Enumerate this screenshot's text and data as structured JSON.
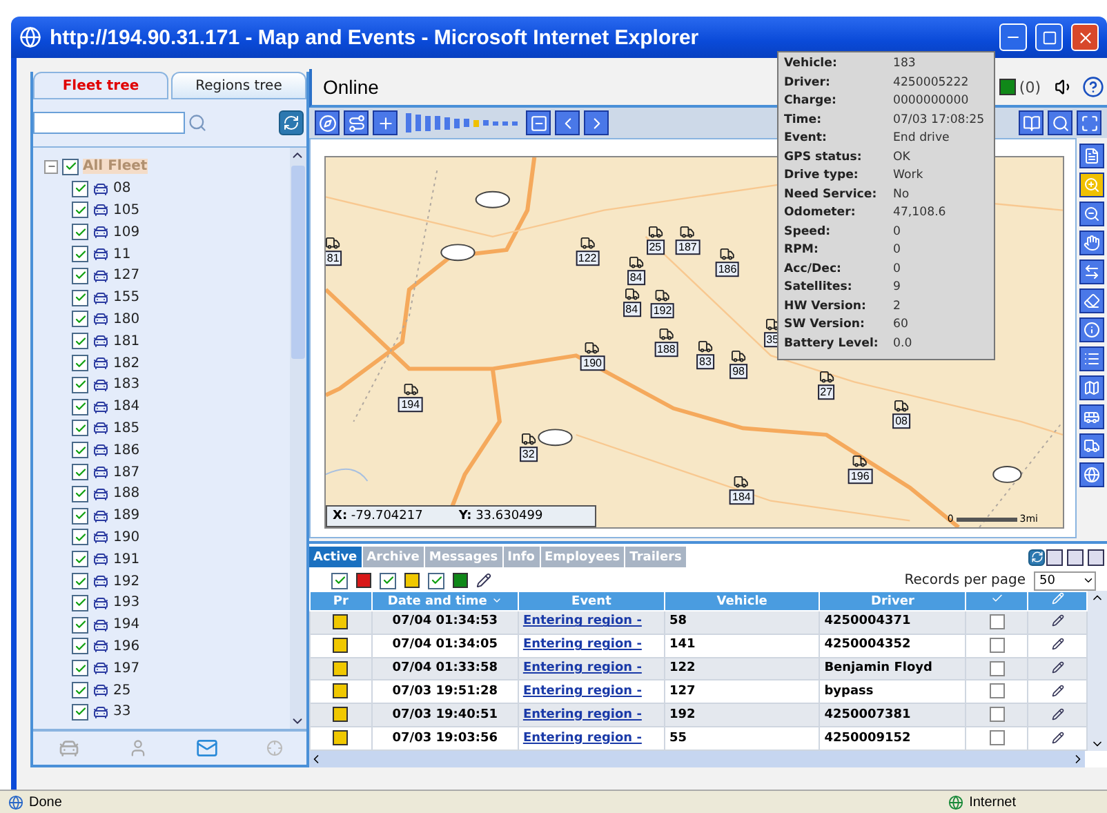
{
  "window": {
    "title": "http://194.90.31.171 - Map and Events - Microsoft Internet Explorer"
  },
  "sidebar": {
    "tabs": [
      {
        "label": "Fleet tree",
        "selected": true
      },
      {
        "label": "Regions tree",
        "selected": false
      }
    ],
    "tree": {
      "label": "All Fleet",
      "checked": true,
      "expanded": true,
      "selected": true,
      "children": [
        {
          "label": "08",
          "checked": true,
          "selected": false
        },
        {
          "label": "105",
          "checked": true,
          "selected": false
        },
        {
          "label": "109",
          "checked": true,
          "selected": false
        },
        {
          "label": "11",
          "checked": true,
          "selected": false
        },
        {
          "label": "127",
          "checked": true,
          "selected": false
        },
        {
          "label": "155",
          "checked": true,
          "selected": false
        },
        {
          "label": "180",
          "checked": true,
          "selected": false
        },
        {
          "label": "181",
          "checked": true,
          "selected": false
        },
        {
          "label": "182",
          "checked": true,
          "selected": false
        },
        {
          "label": "183",
          "checked": true,
          "selected": false
        },
        {
          "label": "184",
          "checked": true,
          "selected": false
        },
        {
          "label": "185",
          "checked": true,
          "selected": false
        },
        {
          "label": "186",
          "checked": true,
          "selected": false
        },
        {
          "label": "187",
          "checked": true,
          "selected": false
        },
        {
          "label": "188",
          "checked": true,
          "selected": false
        },
        {
          "label": "189",
          "checked": true,
          "selected": false
        },
        {
          "label": "190",
          "checked": true,
          "selected": false
        },
        {
          "label": "191",
          "checked": true,
          "selected": false
        },
        {
          "label": "192",
          "checked": true,
          "selected": false
        },
        {
          "label": "193",
          "checked": true,
          "selected": false
        },
        {
          "label": "194",
          "checked": true,
          "selected": false
        },
        {
          "label": "196",
          "checked": true,
          "selected": false
        },
        {
          "label": "197",
          "checked": true,
          "selected": false
        },
        {
          "label": "25",
          "checked": true,
          "selected": false
        },
        {
          "label": "33",
          "checked": true,
          "selected": false
        }
      ]
    }
  },
  "header": {
    "title": "Online",
    "alerts": "(0)"
  },
  "toolbar": {
    "zoom": {
      "level": 0.64
    }
  },
  "tooltip": {
    "rows": [
      {
        "label": "Vehicle:",
        "value": "183"
      },
      {
        "label": "Driver:",
        "value": "4250005222"
      },
      {
        "label": "Charge:",
        "value": "0000000000"
      },
      {
        "label": "Time:",
        "value": "07/03 17:08:25"
      },
      {
        "label": "Event:",
        "value": "End drive"
      },
      {
        "label": "GPS status:",
        "value": "OK"
      },
      {
        "label": "Drive type:",
        "value": "Work"
      },
      {
        "label": "Need Service:",
        "value": "No"
      },
      {
        "label": "Odometer:",
        "value": "47,108.6"
      },
      {
        "label": "Speed:",
        "value": "0"
      },
      {
        "label": "RPM:",
        "value": "0"
      },
      {
        "label": "Acc/Dec:",
        "value": "0"
      },
      {
        "label": "Satellites:",
        "value": "9"
      },
      {
        "label": "HW Version:",
        "value": "2"
      },
      {
        "label": "SW Version:",
        "value": "60"
      },
      {
        "label": "Battery Level:",
        "value": "0.0"
      }
    ]
  },
  "map": {
    "markers": [
      {
        "label": "81"
      },
      {
        "label": "122"
      },
      {
        "label": "25"
      },
      {
        "label": "187"
      },
      {
        "label": "186"
      },
      {
        "label": "84"
      },
      {
        "label": "84"
      },
      {
        "label": "192"
      },
      {
        "label": "188"
      },
      {
        "label": "83"
      },
      {
        "label": "98"
      },
      {
        "label": "190"
      },
      {
        "label": "194"
      },
      {
        "label": "32"
      },
      {
        "label": "27"
      },
      {
        "label": "08"
      },
      {
        "label": "196"
      },
      {
        "label": "184"
      },
      {
        "label": "35"
      }
    ],
    "coordinates": [
      {
        "label": "X:",
        "value": "-79.704217"
      },
      {
        "label": "Y:",
        "value": "33.630499"
      }
    ],
    "scale": {
      "start": "0",
      "end": "3mi"
    }
  },
  "events": {
    "tabs": [
      {
        "label": "Active",
        "selected": true
      },
      {
        "label": "Archive",
        "selected": false
      },
      {
        "label": "Messages",
        "selected": false
      },
      {
        "label": "Info",
        "selected": false
      },
      {
        "label": "Employees",
        "selected": false
      },
      {
        "label": "Trailers",
        "selected": false
      }
    ],
    "filters": [
      {
        "color": "#d81818",
        "checked": true
      },
      {
        "color": "#f0c800",
        "checked": true
      },
      {
        "color": "#108818",
        "checked": true
      }
    ],
    "records_label": "Records per page",
    "records_value": "50",
    "columns": [
      "Pr",
      "Date and time",
      "Event",
      "Vehicle",
      "Driver"
    ],
    "rows": [
      {
        "color": "#f0c800",
        "time": "07/04 01:34:53",
        "event": "Entering region -",
        "vehicle": "58",
        "driver": "4250004371",
        "checked": false
      },
      {
        "color": "#f0c800",
        "time": "07/04 01:34:05",
        "event": "Entering region -",
        "vehicle": "141",
        "driver": "4250004352",
        "checked": false
      },
      {
        "color": "#f0c800",
        "time": "07/04 01:33:58",
        "event": "Entering region -",
        "vehicle": "122",
        "driver": "Benjamin Floyd",
        "checked": false
      },
      {
        "color": "#f0c800",
        "time": "07/03 19:51:28",
        "event": "Entering region -",
        "vehicle": "127",
        "driver": "bypass",
        "checked": false
      },
      {
        "color": "#f0c800",
        "time": "07/03 19:40:51",
        "event": "Entering region -",
        "vehicle": "192",
        "driver": "4250007381",
        "checked": false
      },
      {
        "color": "#f0c800",
        "time": "07/03 19:03:56",
        "event": "Entering region -",
        "vehicle": "55",
        "driver": "4250009152",
        "checked": false
      }
    ]
  },
  "status_bar": {
    "text": "Done",
    "zone": "Internet"
  }
}
